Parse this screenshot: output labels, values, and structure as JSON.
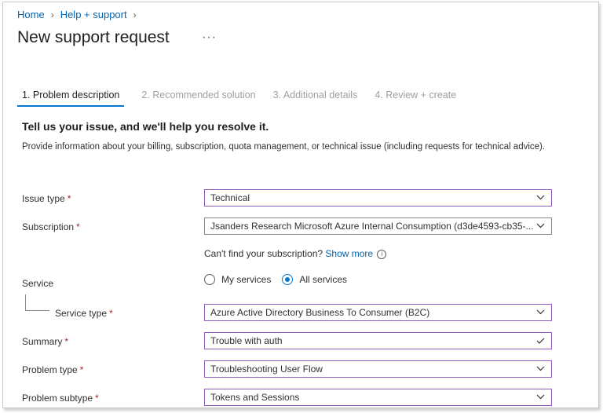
{
  "breadcrumb": {
    "home": "Home",
    "help": "Help + support"
  },
  "page": {
    "title": "New support request",
    "more": "···"
  },
  "tabs": [
    {
      "label": "1. Problem description"
    },
    {
      "label": "2. Recommended solution"
    },
    {
      "label": "3. Additional details"
    },
    {
      "label": "4. Review + create"
    }
  ],
  "intro": {
    "headline": "Tell us your issue, and we'll help you resolve it.",
    "description": "Provide information about your billing, subscription, quota management, or technical issue (including requests for technical advice)."
  },
  "form": {
    "issue_type": {
      "label": "Issue type",
      "value": "Technical"
    },
    "subscription": {
      "label": "Subscription",
      "value": "Jsanders Research Microsoft Azure Internal Consumption (d3de4593-cb35-..."
    },
    "hint": {
      "text": "Can't find your subscription?",
      "link": "Show more"
    },
    "service": {
      "label": "Service",
      "options": [
        "My services",
        "All services"
      ],
      "selected": "All services"
    },
    "service_type": {
      "label": "Service type",
      "value": "Azure Active Directory Business To Consumer (B2C)"
    },
    "summary": {
      "label": "Summary",
      "value": "Trouble with auth"
    },
    "problem_type": {
      "label": "Problem type",
      "value": "Troubleshooting User Flow"
    },
    "problem_subtype": {
      "label": "Problem subtype",
      "value": "Tokens and Sessions"
    },
    "required_mark": "*"
  },
  "colors": {
    "accent": "#0078d4",
    "link": "#0063b1",
    "focus_border": "#8b5cb8",
    "required": "#a4262c"
  }
}
